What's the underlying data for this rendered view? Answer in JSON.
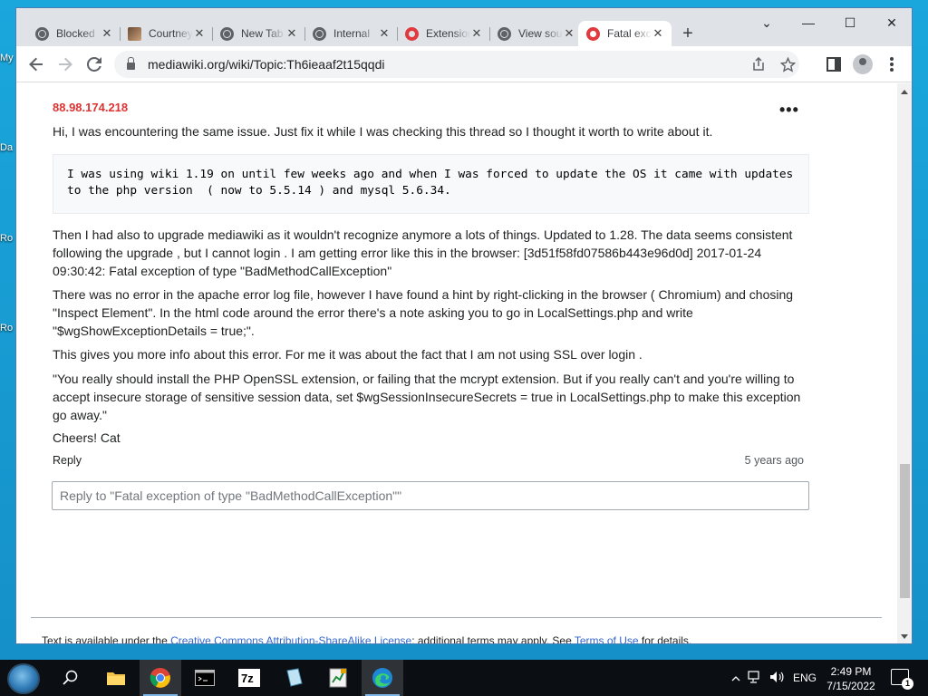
{
  "desktop": {
    "labels": [
      "My",
      "Da",
      "Ro",
      "Ro"
    ]
  },
  "browser": {
    "tabs": [
      {
        "title": "Blocked",
        "icon": "globe-icon",
        "active": false
      },
      {
        "title": "Courtney",
        "icon": "avatar-icon",
        "active": false
      },
      {
        "title": "New Tab",
        "icon": "chrome-icon",
        "active": false
      },
      {
        "title": "Internal",
        "icon": "globe-icon",
        "active": false
      },
      {
        "title": "Extensions",
        "icon": "opera-icon",
        "active": false
      },
      {
        "title": "View source",
        "icon": "globe-icon",
        "active": false
      },
      {
        "title": "Fatal exception",
        "icon": "opera-icon",
        "active": true
      }
    ],
    "tab_close": "✕",
    "new_tab": "+",
    "window_controls": {
      "tab_search": "⌄",
      "minimize": "—",
      "maximize": "☐",
      "close": "✕"
    },
    "address": "mediawiki.org/wiki/Topic:Th6ieaaf2t15qqdi",
    "toolbar_icons": [
      "back-arrow-icon",
      "forward-arrow-icon",
      "reload-icon",
      "share-icon",
      "bookmark-star-icon",
      "side-panel-icon",
      "profile-icon",
      "kebab-menu-icon"
    ]
  },
  "post": {
    "author": "88.98.174.218",
    "more_menu": "•••",
    "paragraph1": "Hi, I was encountering the same issue. Just fix it while I was checking this thread so I thought it worth to write about it.",
    "code": "I was using wiki 1.19 on until few weeks ago and when I was forced to update the OS it came with updates to the php version  ( now to 5.5.14 ) and mysql 5.6.34.",
    "paragraph2": "Then I had also to upgrade mediawiki as it wouldn't recognize anymore a lots of things. Updated to 1.28. The data seems consistent following the upgrade , but I cannot login . I am getting error like this in the browser: [3d51f58fd07586b443e96d0d] 2017-01-24 09:30:42: Fatal exception of type \"BadMethodCallException\"",
    "paragraph3": "There was no error in the apache error log file, however I have found a hint by right-clicking in the browser ( Chromium) and chosing \"Inspect Element\". In the html code around the error there's a note asking you to go in LocalSettings.php and write \"$wgShowExceptionDetails = true;\".",
    "paragraph4": "This gives you more info about this error. For me it was about the fact that I am not using SSL over login .",
    "paragraph5": "\"You really should install the PHP OpenSSL extension, or failing that the mcrypt extension. But if you really can't and you're willing to accept insecure storage of sensitive session data, set $wgSessionInsecureSecrets = true in LocalSettings.php to make this exception go away.\"",
    "paragraph6": "Cheers! Cat",
    "reply_label": "Reply",
    "time_ago": "5 years ago"
  },
  "reply_box": {
    "placeholder": "Reply to \"Fatal exception of type \"BadMethodCallException\"\""
  },
  "footer": {
    "prefix": "Text is available under the ",
    "license_link": "Creative Commons Attribution-ShareAlike License",
    "middle": "; additional terms may apply. See ",
    "terms_link": "Terms of Use",
    "suffix": " for details."
  },
  "taskbar": {
    "apps": [
      "search-icon",
      "file-explorer-icon",
      "chrome-icon",
      "terminal-icon",
      "7zip-icon",
      "notepad-icon",
      "spreadsheet-icon",
      "edge-icon"
    ],
    "language": "ENG",
    "time": "2:49 PM",
    "date": "7/15/2022",
    "notifications": "1"
  }
}
